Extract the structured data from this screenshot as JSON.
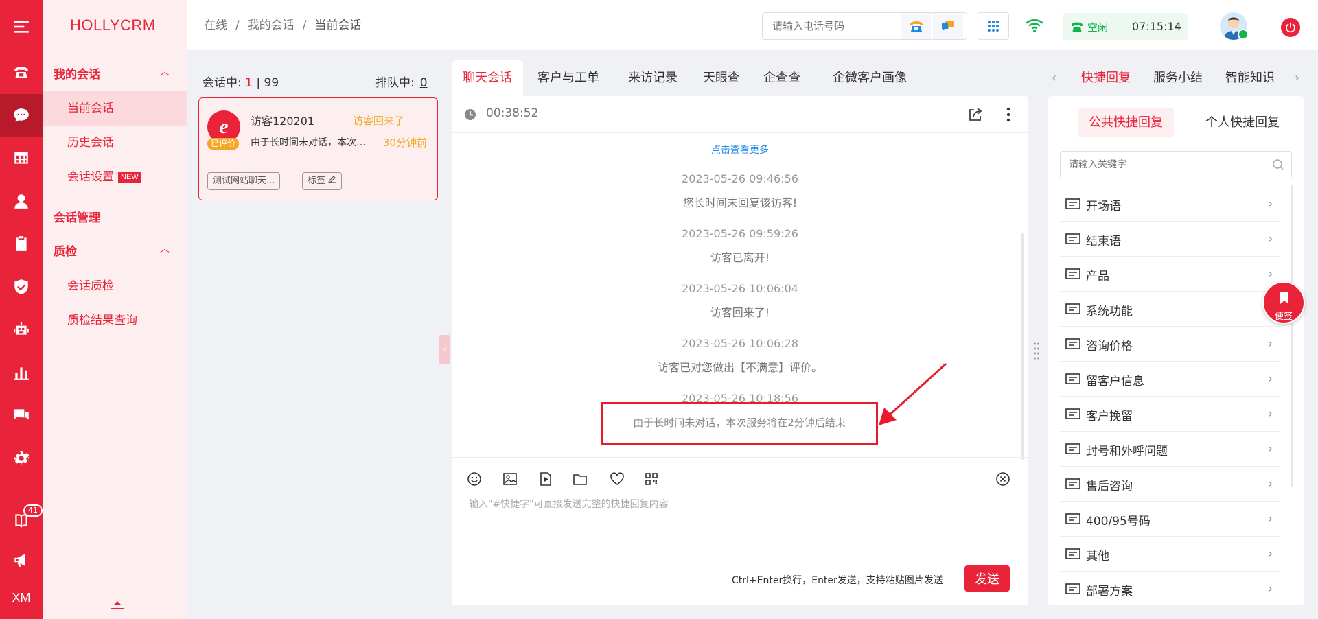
{
  "rail": {
    "badge_count": "41",
    "bottom_text": "XM"
  },
  "menu": {
    "logo": "HOLLYCRM",
    "group_my": "我的会话",
    "item_current": "当前会话",
    "item_history": "历史会话",
    "item_settings": "会话设置",
    "new_tag": "NEW",
    "group_manage": "会话管理",
    "group_qc": "质检",
    "item_qc": "会话质检",
    "item_qc_result": "质检结果查询"
  },
  "header": {
    "crumb_1": "在线",
    "crumb_2": "我的会话",
    "crumb_3": "当前会话",
    "crumb_sep": "/",
    "phone_placeholder": "请输入电话号码",
    "status": "空闲",
    "time": "07:15:14"
  },
  "session_list": {
    "active_label": "会话中:",
    "active_count": "1",
    "active_sep": "|",
    "active_max": "99",
    "queue_label": "排队中:",
    "queue_count": "0",
    "card": {
      "rated": "已评价",
      "name": "访客120201",
      "status": "访客回来了",
      "message": "由于长时间未对话，本次服务将在2分钟后结束",
      "time": "30分钟前",
      "tag_site": "测试网站聊天...",
      "tag_label": "标签"
    }
  },
  "chat": {
    "tabs": [
      "聊天会话",
      "客户与工单",
      "来访记录",
      "天眼查",
      "企查查",
      "企微客户画像"
    ],
    "duration": "00:38:52",
    "load_more": "点击查看更多",
    "events": [
      {
        "time": "2023-05-26 09:46:56",
        "text": "您长时间未回复该访客!"
      },
      {
        "time": "2023-05-26 09:59:26",
        "text": "访客已离开!"
      },
      {
        "time": "2023-05-26 10:06:04",
        "text": "访客回来了!"
      },
      {
        "time": "2023-05-26 10:06:28",
        "text": "访客已对您做出【不满意】评价。"
      },
      {
        "time": "2023-05-26 10:18:56",
        "text": "由于长时间未对话，本次服务将在2分钟后结束"
      }
    ],
    "input_placeholder": "输入\"#快捷字\"可直接发送完整的快捷回复内容",
    "hint": "Ctrl+Enter换行，Enter发送，支持粘贴图片发送",
    "send": "发送"
  },
  "right": {
    "tabs": [
      "快捷回复",
      "服务小结",
      "智能知识"
    ],
    "quick_tabs": [
      "公共快捷回复",
      "个人快捷回复"
    ],
    "keyword_placeholder": "请输入关键字",
    "categories": [
      "开场语",
      "结束语",
      "产品",
      "系统功能",
      "咨询价格",
      "留客户信息",
      "客户挽留",
      "封号和外呼问题",
      "售后咨询",
      "400/95号码",
      "其他",
      "部署方案"
    ],
    "note_button": "便签"
  },
  "colors": {
    "brand": "#e8233a",
    "status_green": "#13b44a",
    "warning": "#f5a623",
    "link": "#1e88e5"
  }
}
